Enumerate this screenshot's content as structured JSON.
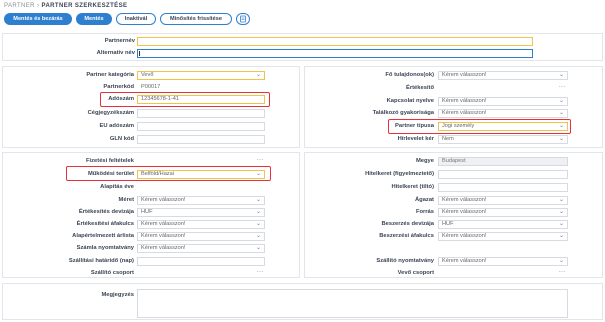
{
  "breadcrumb": {
    "parent": "PARTNER",
    "separator": "›",
    "current": "PARTNER SZERKESZTÉSE"
  },
  "toolbar": {
    "save_close": "Mentés és bezárás",
    "save": "Mentés",
    "inactivate": "Inaktivál",
    "refresh_rating": "Minősítés frissítése",
    "icon": "copy-icon"
  },
  "top": {
    "partner_name_label": "Partnernév",
    "partner_name_value": "",
    "alt_name_label": "Alternatív név",
    "alt_name_value": ""
  },
  "left1": {
    "category_label": "Partner kategória",
    "category_value": "Vevő",
    "code_label": "Partnerkód",
    "code_value": "P00017",
    "tax_label": "Adószám",
    "tax_value": "12345678-1-41",
    "company_reg_label": "Cégjegyzékszám",
    "company_reg_value": "",
    "eu_tax_label": "EU adószám",
    "eu_tax_value": "",
    "gln_label": "GLN kód",
    "gln_value": ""
  },
  "right1": {
    "owner_label": "Fő tulajdonos(ok)",
    "owner_value": "Kérem válasszon!",
    "rating_label": "Értékesítő",
    "rating_value": "...",
    "language_label": "Kapcsolat nyelve",
    "language_value": "Kérem válasszon!",
    "frequency_label": "Találkozó gyakorisága",
    "frequency_value": "Kérem válasszon!",
    "type_label": "Partner típusa",
    "type_value": "Jogi személy",
    "newsletter_label": "Hírlevelet kér",
    "newsletter_value": "Nem"
  },
  "left2": {
    "payment_label": "Fizetési feltételek",
    "payment_value": "...",
    "area_label": "Működési terület",
    "area_value": "Belföld/Hazai",
    "founded_label": "Alapítás éve",
    "founded_value": "",
    "size_label": "Méret",
    "size_value": "Kérem válasszon!",
    "sales_currency_label": "Értékesítés devizája",
    "sales_currency_value": "HUF",
    "sales_vat_label": "Értékesítési áfakulcs",
    "sales_vat_value": "Kérem válasszon!",
    "pricelist_label": "Alapértelmezett árlista",
    "pricelist_value": "Kérem válasszon!",
    "invoice_label": "Számla nyomtatvány",
    "invoice_value": "Kérem válasszon!",
    "delivery_label": "Szállítási határidő (nap)",
    "delivery_value": "",
    "carrier_label": "Szállító csoport",
    "carrier_value": "..."
  },
  "right2": {
    "county_label": "Megye",
    "county_value": "Budapest",
    "credit_label": "Hitelkeret (figyelmeztető)",
    "credit_value": "",
    "credit_block_label": "Hitelkeret (tiltó)",
    "credit_block_value": "",
    "branch_label": "Ágazat",
    "branch_value": "Kérem válasszon!",
    "source_label": "Forrás",
    "source_value": "Kérem válasszon!",
    "purchase_currency_label": "Beszerzés devizája",
    "purchase_currency_value": "HUF",
    "purchase_vat_label": "Beszerzési áfakulcs",
    "purchase_vat_value": "Kérem válasszon!",
    "delivery_form_label": "Szállító nyomtatvány",
    "delivery_form_value": "Kérem válasszon!",
    "customer_group_label": "Vevő csoport",
    "customer_group_value": "..."
  },
  "notes": {
    "label": "Megjegyzés",
    "value": ""
  },
  "colors": {
    "accent": "#2f7fd0",
    "highlight": "#e8303a",
    "required": "#f0c34a"
  }
}
